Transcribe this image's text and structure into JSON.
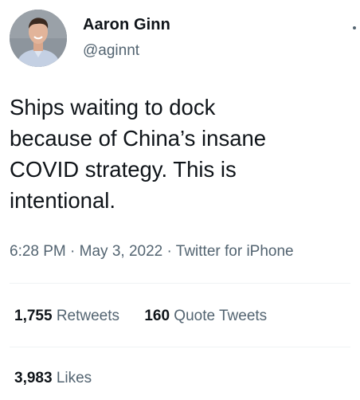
{
  "author": {
    "name": "Aaron Ginn",
    "handle": "@aginnt"
  },
  "tweet": {
    "text": "Ships waiting to dock\nbecause of China’s insane\nCOVID strategy. This is\nintentional.",
    "time": "6:28 PM",
    "date": "May 3, 2022",
    "source": "Twitter for iPhone",
    "separator": " · "
  },
  "stats": {
    "retweets_count": "1,755",
    "retweets_label": "Retweets",
    "quotes_count": "160",
    "quotes_label": "Quote Tweets",
    "likes_count": "3,983",
    "likes_label": "Likes"
  },
  "icons": {
    "more": "more-options-icon"
  },
  "colors": {
    "text_primary": "#0f1419",
    "text_secondary": "#536471",
    "divider": "#eff3f4"
  }
}
